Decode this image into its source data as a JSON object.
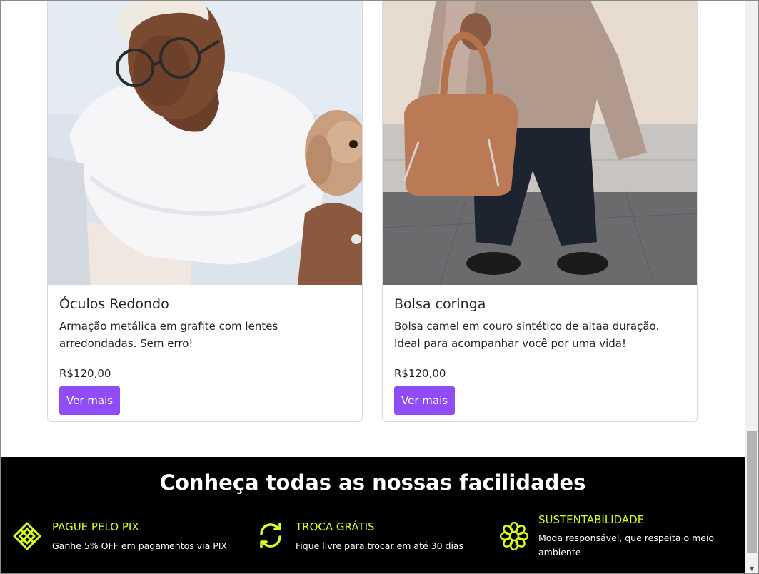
{
  "products": [
    {
      "title": "Óculos Redondo",
      "description": "Armação metálica em grafite com lentes arredondadas. Sem erro!",
      "price": "R$120,00",
      "button": "Ver mais"
    },
    {
      "title": "Bolsa coringa",
      "description": "Bolsa camel em couro sintético de altaa duração. Ideal para acompanhar você por uma vida!",
      "price": "R$120,00",
      "button": "Ver mais"
    }
  ],
  "footer": {
    "title": "Conheça todas as nossas facilidades",
    "features": [
      {
        "icon": "pix-icon",
        "title": "PAGUE PELO PIX",
        "description": "Ganhe 5% OFF em pagamentos via PIX"
      },
      {
        "icon": "exchange-icon",
        "title": "TROCA GRÁTIS",
        "description": "Fique livre para trocar em até 30 dias"
      },
      {
        "icon": "flower-icon",
        "title": "SUSTENTABILIDADE",
        "description": "Moda responsável, que respeita o meio ambiente"
      }
    ]
  },
  "colors": {
    "button": "#8f4cf7",
    "accent": "#d6ff1f",
    "footer_bg": "#000000"
  }
}
